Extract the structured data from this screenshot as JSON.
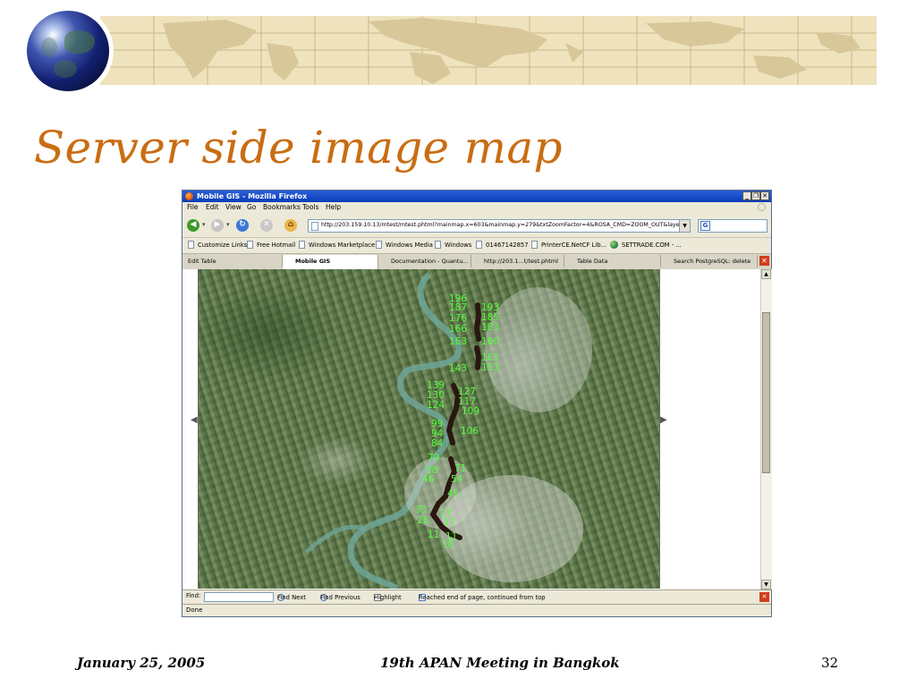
{
  "slide": {
    "title": "Server side image map",
    "footer_date": "January 25, 2005",
    "footer_event": "19th APAN Meeting in Bangkok",
    "page_number": "32",
    "title_color": "#c96d12"
  },
  "browser": {
    "window_title": "Mobile GIS - Mozilla Firefox",
    "window_buttons": {
      "minimize": "_",
      "restore": "❐",
      "close": "✕"
    },
    "menu": [
      "File",
      "Edit",
      "View",
      "Go",
      "Bookmarks",
      "Tools",
      "Help"
    ],
    "url": "http://203.159.10.13/mtest/mtest.phtml?mainmap.x=603&mainmap.y=279&txtZoomFactor=4&ROSA_CMD=ZOOM_OUT&layer_",
    "search_icon": "G",
    "bookmarks": [
      "Customize Links",
      "Free Hotmail",
      "Windows Marketplace",
      "Windows Media",
      "Windows",
      "01467142857",
      "PrinterCE.NetCF Lib...",
      "SETTRADE.COM - ..."
    ],
    "tabs": [
      {
        "label": "Edit Table",
        "active": false
      },
      {
        "label": "Mobile GIS",
        "active": true
      },
      {
        "label": "Documentation - Quantu...",
        "active": false
      },
      {
        "label": "http://203.1...t/test.phtml",
        "active": false
      },
      {
        "label": "Table Data",
        "active": false
      },
      {
        "label": "Search PostgreSQL: delete",
        "active": false
      }
    ],
    "find": {
      "label": "Find:",
      "value": "",
      "next": "Find Next",
      "previous": "Find Previous",
      "highlight": "Highlight",
      "message": "Reached end of page, continued from top"
    },
    "status": "Done",
    "icons": {
      "back": "back-arrow-icon",
      "forward": "forward-arrow-icon",
      "reload": "reload-icon",
      "stop": "stop-icon",
      "home": "home-icon"
    }
  },
  "map": {
    "route_labels": [
      "196",
      "187",
      "193",
      "185",
      "176",
      "183",
      "166",
      "163",
      "160",
      "161",
      "153",
      "143",
      "139",
      "130",
      "127",
      "117",
      "124",
      "109",
      "99",
      "106",
      "94",
      "84",
      "79",
      "71",
      "58",
      "54",
      "46",
      "45",
      "33",
      "27",
      "26",
      "17",
      "11",
      "11",
      "10"
    ],
    "label_color": "#54ff3c",
    "route_color": "#2a1810"
  }
}
